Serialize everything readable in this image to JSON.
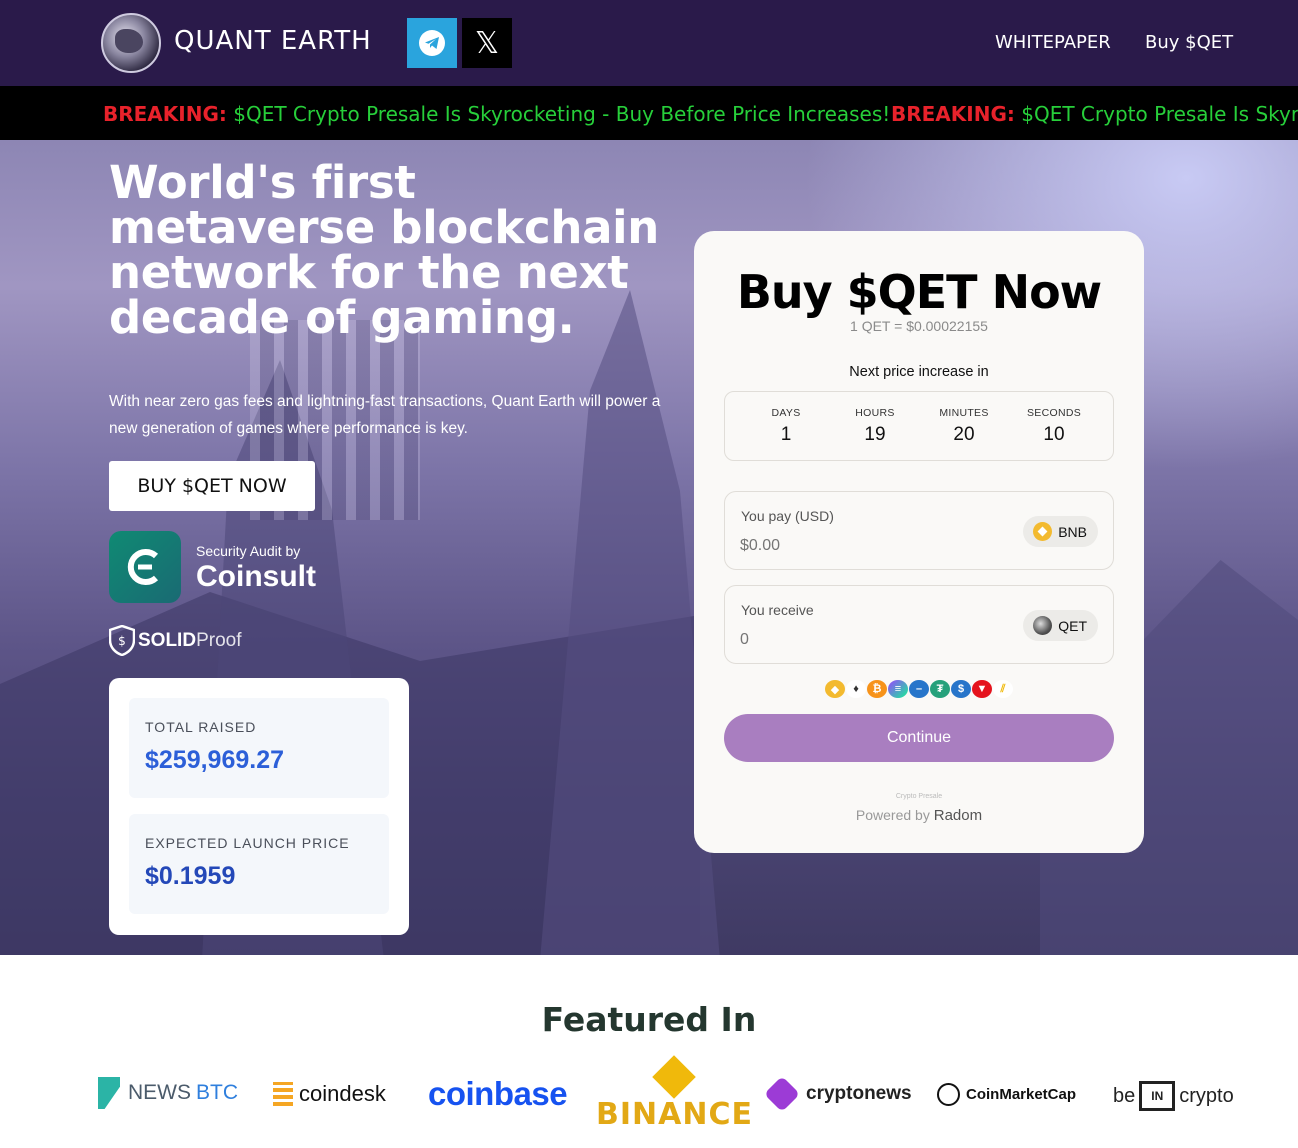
{
  "header": {
    "brand": "QUANT EARTH",
    "nav": {
      "whitepaper": "WHITEPAPER",
      "buy": "Buy $QET"
    }
  },
  "ticker": {
    "items": [
      {
        "label": "BREAKING:",
        "text": "$QET Crypto Presale Is Skyrocketing - Buy Before Price Increases!"
      },
      {
        "label": "BREAKING:",
        "text": "$QET Crypto Presale Is Skyrock"
      }
    ]
  },
  "hero": {
    "headline": "World's first metaverse blockchain network for the next decade of gaming.",
    "subcopy": "With near zero gas fees and lightning-fast transactions, Quant Earth will power a new generation of games where performance is key.",
    "cta": "BUY $QET NOW",
    "audit": {
      "small": "Security Audit by",
      "big": "Coinsult"
    },
    "solidproof": {
      "solid": "SOLID",
      "proof": "Proof"
    },
    "stats": {
      "total_raised_label": "TOTAL RAISED",
      "total_raised_value": "$259,969.27",
      "launch_price_label": "EXPECTED LAUNCH PRICE",
      "launch_price_value": "$0.1959"
    }
  },
  "widget": {
    "title": "Buy $QET Now",
    "rate": "1 QET = $0.00022155",
    "next_increase": "Next price increase in",
    "countdown": [
      {
        "label": "DAYS",
        "value": "1"
      },
      {
        "label": "HOURS",
        "value": "19"
      },
      {
        "label": "MINUTES",
        "value": "20"
      },
      {
        "label": "SECONDS",
        "value": "10"
      }
    ],
    "pay": {
      "label": "You pay (USD)",
      "placeholder": "$0.00",
      "token": "BNB"
    },
    "receive": {
      "label": "You receive",
      "placeholder": "0",
      "token": "QET"
    },
    "continue": "Continue",
    "tiny": "Crypto Presale",
    "powered_prefix": "Powered by",
    "powered_brand": "Radom"
  },
  "featured": {
    "title": "Featured In",
    "logos": {
      "newsbtc_a": "NEWS",
      "newsbtc_b": "BTC",
      "coindesk": "coindesk",
      "coinbase": "coinbase",
      "binance": "BINANCE",
      "cryptonews": "cryptonews",
      "coinmarketcap": "CoinMarketCap",
      "beincrypto_a": "be",
      "beincrypto_b": "IN",
      "beincrypto_c": "crypto"
    }
  },
  "colors": {
    "header_bg": "#2a1a4a",
    "ticker_red": "#e8222b",
    "ticker_green": "#27cf3a",
    "accent_blue": "#2c5fd8",
    "continue_purple": "#a97ec0",
    "coinbase_blue": "#1652f0",
    "binance_yellow": "#f0b90b"
  },
  "icons": [
    "globe-logo-icon",
    "telegram-icon",
    "x-icon",
    "coinsult-icon",
    "solidproof-shield-icon",
    "bnb-icon",
    "qet-icon",
    "eth-icon",
    "btc-icon",
    "sol-icon",
    "usdt-icon",
    "usdc-icon",
    "tron-icon"
  ]
}
